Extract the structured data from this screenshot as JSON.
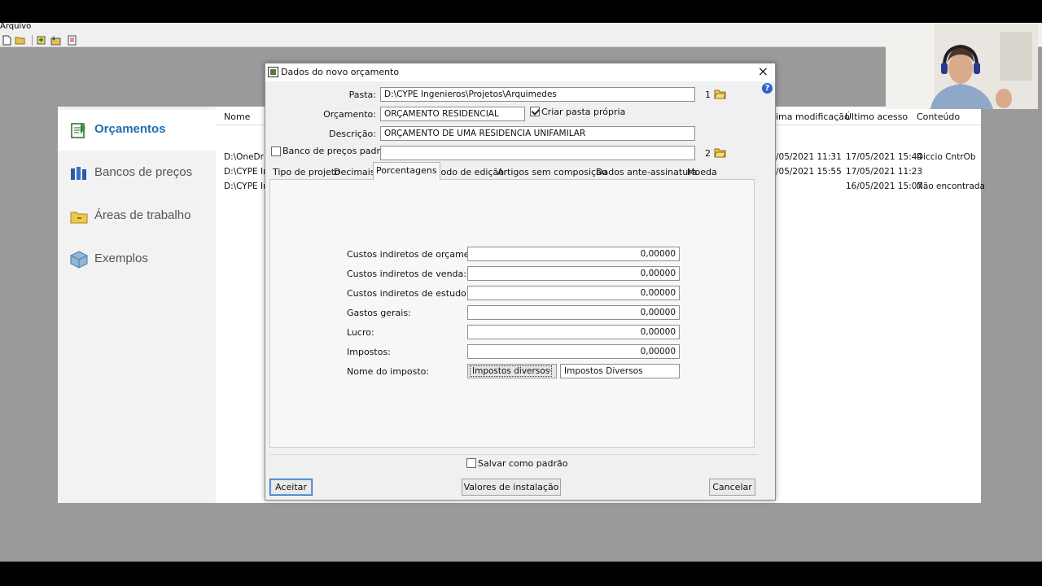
{
  "menubar": {
    "arquivo": "Arquivo"
  },
  "toolbar": {
    "icons": [
      "new-file-icon",
      "open-folder-icon",
      "add-budget-icon",
      "import-icon",
      "print-icon"
    ]
  },
  "nav": {
    "items": [
      {
        "label": "Orçamentos",
        "icon": "budgets-icon",
        "active": true
      },
      {
        "label": "Bancos de preços",
        "icon": "price-banks-icon",
        "active": false
      },
      {
        "label": "Áreas de trabalho",
        "icon": "workspaces-icon",
        "active": false
      },
      {
        "label": "Exemplos",
        "icon": "examples-icon",
        "active": false
      }
    ]
  },
  "filelist": {
    "headers": {
      "name": "Nome",
      "modified": "ima modificação",
      "accessed": "Último acesso",
      "content": "Conteúdo"
    },
    "rows": [
      {
        "name": "D:\\OneDriv",
        "modified": "/05/2021 11:31",
        "accessed": "17/05/2021 15:44",
        "content": "Diccio CntrOb"
      },
      {
        "name": "D:\\CYPE In",
        "modified": "/05/2021 15:55",
        "accessed": "17/05/2021 11:23",
        "content": ""
      },
      {
        "name": "D:\\CYPE In",
        "modified": "",
        "accessed": "16/05/2021 15:07",
        "content": "Não encontrada"
      }
    ]
  },
  "dialog": {
    "title": "Dados do novo orçamento",
    "close": "×",
    "help": "?",
    "pasta_label": "Pasta:",
    "pasta_value": "D:\\CYPE Ingenieros\\Projetos\\Arquimedes",
    "pasta_num": "1",
    "orcamento_label": "Orçamento:",
    "orcamento_value": "ORÇAMENTO RESIDENCIAL",
    "criar_pasta_label": "Criar pasta própria",
    "criar_pasta_checked": true,
    "descricao_label": "Descrição:",
    "descricao_value": "ORÇAMENTO DE UMA RESIDENCIA UNIFAMILAR",
    "banco_label": "Banco de preços padrão",
    "banco_checked": false,
    "banco_value": "",
    "banco_num": "2",
    "tabs": [
      "Tipo de projeto",
      "Decimais",
      "Porcentagens",
      "Modo de edição",
      "Artigos sem composição",
      "Dados ante-assinatura",
      "Moeda"
    ],
    "active_tab": 2,
    "fields": [
      {
        "label": "Custos indiretos de orçamento:",
        "value": "0,00000"
      },
      {
        "label": "Custos indiretos de venda:",
        "value": "0,00000"
      },
      {
        "label": "Custos indiretos de estudo:",
        "value": "0,00000"
      },
      {
        "label": "Gastos gerais:",
        "value": "0,00000"
      },
      {
        "label": "Lucro:",
        "value": "0,00000"
      },
      {
        "label": "Impostos:",
        "value": "0,00000"
      }
    ],
    "imposto_label": "Nome do imposto:",
    "imposto_select": "Impostos diversos",
    "imposto_text": "Impostos Diversos",
    "salvar_label": "Salvar como padrão",
    "salvar_checked": false,
    "btn_aceitar": "Aceitar",
    "btn_valores": "Valores de instalação",
    "btn_cancelar": "Cancelar"
  },
  "colors": {
    "accent": "#1f6fb3",
    "window_bg": "#9a9a9a",
    "dialog_bg": "#f0f0f0"
  }
}
